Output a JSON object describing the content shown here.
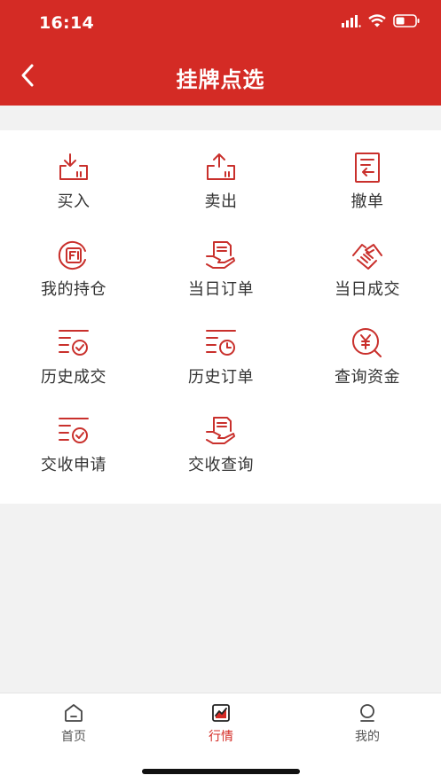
{
  "status_bar": {
    "time": "16:14"
  },
  "nav": {
    "title": "挂牌点选",
    "back_icon": "chevron-left-icon"
  },
  "accent_color": "#d42b25",
  "menu": [
    {
      "label": "买入",
      "icon": "buy-tray-icon"
    },
    {
      "label": "卖出",
      "icon": "sell-tray-icon"
    },
    {
      "label": "撤单",
      "icon": "cancel-order-icon"
    },
    {
      "label": "我的持仓",
      "icon": "position-icon"
    },
    {
      "label": "当日订单",
      "icon": "order-hand-icon"
    },
    {
      "label": "当日成交",
      "icon": "handshake-icon"
    },
    {
      "label": "历史成交",
      "icon": "list-check-icon"
    },
    {
      "label": "历史订单",
      "icon": "list-clock-icon"
    },
    {
      "label": "查询资金",
      "icon": "yuan-search-icon"
    },
    {
      "label": "交收申请",
      "icon": "list-check-icon"
    },
    {
      "label": "交收查询",
      "icon": "order-hand-icon"
    }
  ],
  "tabbar": {
    "items": [
      {
        "label": "首页",
        "icon": "home-icon"
      },
      {
        "label": "行情",
        "icon": "market-chart-icon"
      },
      {
        "label": "我的",
        "icon": "person-icon"
      }
    ],
    "active_index": 1
  }
}
